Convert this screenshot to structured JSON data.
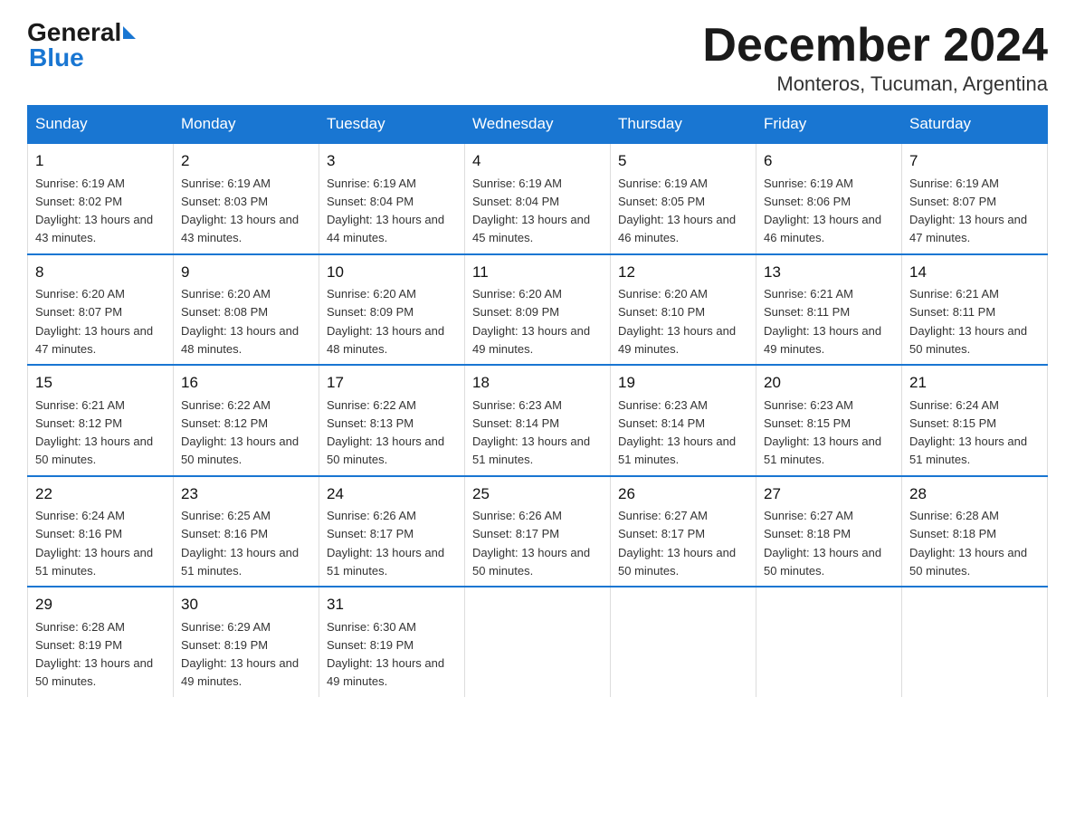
{
  "logo": {
    "general": "General",
    "blue": "Blue"
  },
  "title": "December 2024",
  "location": "Monteros, Tucuman, Argentina",
  "headers": [
    "Sunday",
    "Monday",
    "Tuesday",
    "Wednesday",
    "Thursday",
    "Friday",
    "Saturday"
  ],
  "weeks": [
    [
      {
        "day": "1",
        "sunrise": "6:19 AM",
        "sunset": "8:02 PM",
        "daylight": "13 hours and 43 minutes."
      },
      {
        "day": "2",
        "sunrise": "6:19 AM",
        "sunset": "8:03 PM",
        "daylight": "13 hours and 43 minutes."
      },
      {
        "day": "3",
        "sunrise": "6:19 AM",
        "sunset": "8:04 PM",
        "daylight": "13 hours and 44 minutes."
      },
      {
        "day": "4",
        "sunrise": "6:19 AM",
        "sunset": "8:04 PM",
        "daylight": "13 hours and 45 minutes."
      },
      {
        "day": "5",
        "sunrise": "6:19 AM",
        "sunset": "8:05 PM",
        "daylight": "13 hours and 46 minutes."
      },
      {
        "day": "6",
        "sunrise": "6:19 AM",
        "sunset": "8:06 PM",
        "daylight": "13 hours and 46 minutes."
      },
      {
        "day": "7",
        "sunrise": "6:19 AM",
        "sunset": "8:07 PM",
        "daylight": "13 hours and 47 minutes."
      }
    ],
    [
      {
        "day": "8",
        "sunrise": "6:20 AM",
        "sunset": "8:07 PM",
        "daylight": "13 hours and 47 minutes."
      },
      {
        "day": "9",
        "sunrise": "6:20 AM",
        "sunset": "8:08 PM",
        "daylight": "13 hours and 48 minutes."
      },
      {
        "day": "10",
        "sunrise": "6:20 AM",
        "sunset": "8:09 PM",
        "daylight": "13 hours and 48 minutes."
      },
      {
        "day": "11",
        "sunrise": "6:20 AM",
        "sunset": "8:09 PM",
        "daylight": "13 hours and 49 minutes."
      },
      {
        "day": "12",
        "sunrise": "6:20 AM",
        "sunset": "8:10 PM",
        "daylight": "13 hours and 49 minutes."
      },
      {
        "day": "13",
        "sunrise": "6:21 AM",
        "sunset": "8:11 PM",
        "daylight": "13 hours and 49 minutes."
      },
      {
        "day": "14",
        "sunrise": "6:21 AM",
        "sunset": "8:11 PM",
        "daylight": "13 hours and 50 minutes."
      }
    ],
    [
      {
        "day": "15",
        "sunrise": "6:21 AM",
        "sunset": "8:12 PM",
        "daylight": "13 hours and 50 minutes."
      },
      {
        "day": "16",
        "sunrise": "6:22 AM",
        "sunset": "8:12 PM",
        "daylight": "13 hours and 50 minutes."
      },
      {
        "day": "17",
        "sunrise": "6:22 AM",
        "sunset": "8:13 PM",
        "daylight": "13 hours and 50 minutes."
      },
      {
        "day": "18",
        "sunrise": "6:23 AM",
        "sunset": "8:14 PM",
        "daylight": "13 hours and 51 minutes."
      },
      {
        "day": "19",
        "sunrise": "6:23 AM",
        "sunset": "8:14 PM",
        "daylight": "13 hours and 51 minutes."
      },
      {
        "day": "20",
        "sunrise": "6:23 AM",
        "sunset": "8:15 PM",
        "daylight": "13 hours and 51 minutes."
      },
      {
        "day": "21",
        "sunrise": "6:24 AM",
        "sunset": "8:15 PM",
        "daylight": "13 hours and 51 minutes."
      }
    ],
    [
      {
        "day": "22",
        "sunrise": "6:24 AM",
        "sunset": "8:16 PM",
        "daylight": "13 hours and 51 minutes."
      },
      {
        "day": "23",
        "sunrise": "6:25 AM",
        "sunset": "8:16 PM",
        "daylight": "13 hours and 51 minutes."
      },
      {
        "day": "24",
        "sunrise": "6:26 AM",
        "sunset": "8:17 PM",
        "daylight": "13 hours and 51 minutes."
      },
      {
        "day": "25",
        "sunrise": "6:26 AM",
        "sunset": "8:17 PM",
        "daylight": "13 hours and 50 minutes."
      },
      {
        "day": "26",
        "sunrise": "6:27 AM",
        "sunset": "8:17 PM",
        "daylight": "13 hours and 50 minutes."
      },
      {
        "day": "27",
        "sunrise": "6:27 AM",
        "sunset": "8:18 PM",
        "daylight": "13 hours and 50 minutes."
      },
      {
        "day": "28",
        "sunrise": "6:28 AM",
        "sunset": "8:18 PM",
        "daylight": "13 hours and 50 minutes."
      }
    ],
    [
      {
        "day": "29",
        "sunrise": "6:28 AM",
        "sunset": "8:19 PM",
        "daylight": "13 hours and 50 minutes."
      },
      {
        "day": "30",
        "sunrise": "6:29 AM",
        "sunset": "8:19 PM",
        "daylight": "13 hours and 49 minutes."
      },
      {
        "day": "31",
        "sunrise": "6:30 AM",
        "sunset": "8:19 PM",
        "daylight": "13 hours and 49 minutes."
      },
      null,
      null,
      null,
      null
    ]
  ]
}
